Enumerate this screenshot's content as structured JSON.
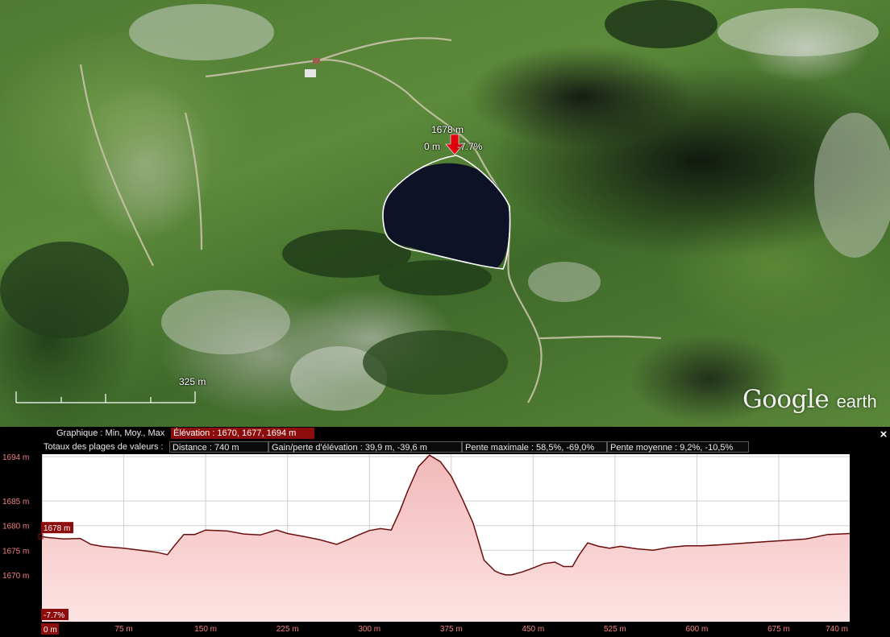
{
  "map": {
    "marker": {
      "elevation": "1678 m",
      "distance": "0 m",
      "slope": "-7.7%"
    },
    "scale_label": "325  m",
    "logo": {
      "google": "Google",
      "earth": "earth"
    },
    "colors": {
      "path": "#ffffff",
      "marker": "#e0000d",
      "lake": "#0d1226"
    }
  },
  "panel": {
    "graph_label": "Graphique : Min, Moy., Max",
    "elevation_stats": "Élévation : 1670, 1677, 1694 m",
    "totals_label": "Totaux des plages de valeurs :",
    "distance": "Distance : 740 m",
    "gain_loss": "Gain/perte d'élévation : 39,9 m, -39,6 m",
    "max_slope": "Pente maximale : 58,5%, -69,0%",
    "avg_slope": "Pente moyenne : 9,2%, -10,5%",
    "close_icon": "×",
    "cursor_elevation": "1678 m",
    "cursor_slope": "-7.7%",
    "cursor_distance": "0 m",
    "colors": {
      "line": "#6b0d0d",
      "fill_top": "#f2b9b9",
      "fill_bottom": "#fde3e3",
      "accent": "#8d0c0c"
    }
  },
  "chart_data": {
    "type": "area",
    "title": "",
    "xlabel": "",
    "ylabel": "",
    "y_tick_labels": [
      "1694 m",
      "1685 m",
      "1680 m",
      "1675 m",
      "1670 m"
    ],
    "y_ticks": [
      1694,
      1685,
      1680,
      1675,
      1670
    ],
    "x_tick_labels": [
      "75 m",
      "150 m",
      "225 m",
      "300 m",
      "375 m",
      "450 m",
      "525 m",
      "600 m",
      "675 m",
      "740 m"
    ],
    "x_ticks": [
      75,
      150,
      225,
      300,
      375,
      450,
      525,
      600,
      675,
      740
    ],
    "xlim": [
      0,
      740
    ],
    "ylim": [
      1660.5,
      1694.5
    ],
    "grid": true,
    "series": [
      {
        "x": [
          0,
          5,
          20,
          35,
          45,
          55,
          65,
          75,
          90,
          105,
          115,
          122,
          130,
          140,
          150,
          170,
          185,
          200,
          215,
          225,
          240,
          255,
          270,
          280,
          290,
          300,
          310,
          320,
          328,
          335,
          345,
          355,
          365,
          370,
          375,
          385,
          395,
          405,
          415,
          420,
          425,
          430,
          440,
          450,
          460,
          470,
          478,
          486,
          492,
          500,
          510,
          520,
          530,
          545,
          560,
          575,
          590,
          605,
          620,
          640,
          660,
          680,
          700,
          720,
          740
        ],
        "y": [
          1677.8,
          1677.6,
          1677.3,
          1677.4,
          1676.2,
          1675.8,
          1675.6,
          1675.4,
          1675.0,
          1674.6,
          1674.1,
          1676.1,
          1678.2,
          1678.2,
          1679.1,
          1678.9,
          1678.3,
          1678.1,
          1679.1,
          1678.4,
          1677.8,
          1677.1,
          1676.2,
          1677.1,
          1678.1,
          1679.0,
          1679.4,
          1679.1,
          1683.0,
          1687.0,
          1692.0,
          1694.3,
          1693.0,
          1691.5,
          1690.0,
          1685.5,
          1680.5,
          1673.0,
          1670.8,
          1670.3,
          1670.0,
          1670.0,
          1670.6,
          1671.4,
          1672.3,
          1672.6,
          1671.7,
          1671.7,
          1674.0,
          1676.5,
          1675.8,
          1675.4,
          1675.8,
          1675.3,
          1675.0,
          1675.6,
          1675.9,
          1675.9,
          1676.1,
          1676.4,
          1676.7,
          1677.0,
          1677.3,
          1678.2,
          1678.4
        ]
      }
    ]
  }
}
